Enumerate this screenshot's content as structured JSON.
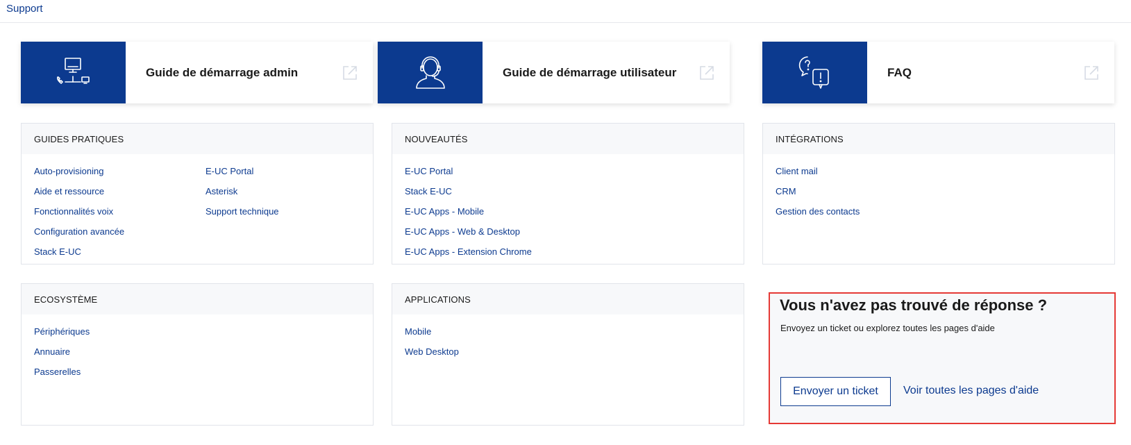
{
  "topbar": {
    "support_label": "Support"
  },
  "quick_cards": [
    {
      "title": "Guide de démarrage admin",
      "icon": "computer-phone-network-icon"
    },
    {
      "title": "Guide de démarrage utilisateur",
      "icon": "headset-user-icon"
    },
    {
      "title": "FAQ",
      "icon": "question-exclamation-bubbles-icon"
    }
  ],
  "sections": {
    "guides": {
      "title": "GUIDES PRATIQUES",
      "links_col1": [
        "Auto-provisioning",
        "Aide et ressource",
        "Fonctionnalités voix",
        "Configuration avancée",
        "Stack E-UC"
      ],
      "links_col2": [
        "E-UC Portal",
        "Asterisk",
        "Support technique"
      ]
    },
    "nouveautes": {
      "title": "NOUVEAUTÉS",
      "links": [
        "E-UC Portal",
        "Stack E-UC",
        "E-UC Apps - Mobile",
        "E-UC Apps - Web & Desktop",
        "E-UC Apps - Extension Chrome"
      ]
    },
    "integrations": {
      "title": "INTÉGRATIONS",
      "links": [
        "Client mail",
        "CRM",
        "Gestion des contacts"
      ]
    },
    "ecosysteme": {
      "title": "ECOSYSTÈME",
      "links": [
        "Périphériques",
        "Annuaire",
        "Passerelles"
      ]
    },
    "applications": {
      "title": "APPLICATIONS",
      "links": [
        "Mobile",
        "Web Desktop"
      ]
    }
  },
  "help": {
    "title": "Vous n'avez pas trouvé de réponse ?",
    "subtitle": "Envoyez un ticket ou explorez toutes les pages d'aide",
    "ticket_button": "Envoyer un ticket",
    "all_pages_link": "Voir toutes les pages d'aide"
  },
  "colors": {
    "brand": "#0c3a8f",
    "highlight_border": "#e53935",
    "panel_bg": "#f7f8fa"
  }
}
